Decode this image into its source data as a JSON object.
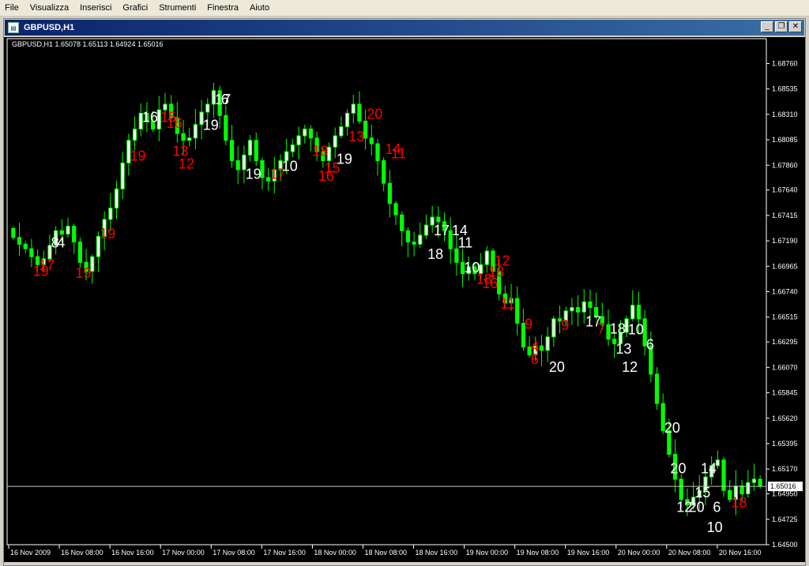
{
  "menu": [
    "File",
    "Visualizza",
    "Inserisci",
    "Grafici",
    "Strumenti",
    "Finestra",
    "Aiuto"
  ],
  "window": {
    "title": "GBPUSD,H1",
    "buttons": {
      "minimize": "_",
      "restore": "❐",
      "close": "✕"
    }
  },
  "chart_header": "GBPUSD,H1  1.65078 1.65113 1.64924 1.65016",
  "colors": {
    "bull": "#ffffff",
    "bear": "#00ff00",
    "label_white": "#ffffff",
    "label_red": "#ff0000",
    "axis": "#ffffff",
    "price_line": "#c0c0c0"
  },
  "chart_data": {
    "type": "candlestick",
    "symbol": "GBPUSD",
    "timeframe": "H1",
    "last_price": "1.65016",
    "ylim": [
      1.645,
      1.6898
    ],
    "y_ticks": [
      "1.68760",
      "1.68535",
      "1.68310",
      "1.68085",
      "1.67860",
      "1.67640",
      "1.67415",
      "1.67190",
      "1.66965",
      "1.66740",
      "1.66515",
      "1.66295",
      "1.66070",
      "1.65845",
      "1.65620",
      "1.65395",
      "1.65170",
      "1.64950",
      "1.64725",
      "1.64500"
    ],
    "x_ticks": [
      "16 Nov 2009",
      "16 Nov 08:00",
      "16 Nov 16:00",
      "17 Nov 00:00",
      "17 Nov 08:00",
      "17 Nov 16:00",
      "18 Nov 00:00",
      "18 Nov 08:00",
      "18 Nov 16:00",
      "19 Nov 00:00",
      "19 Nov 08:00",
      "19 Nov 16:00",
      "20 Nov 00:00",
      "20 Nov 08:00",
      "20 Nov 16:00"
    ],
    "close": [
      1.6722,
      1.6716,
      1.6712,
      1.6705,
      1.6698,
      1.6703,
      1.6715,
      1.6728,
      1.6725,
      1.6732,
      1.6718,
      1.67,
      1.6692,
      1.6705,
      1.6723,
      1.6738,
      1.6748,
      1.6765,
      1.6788,
      1.6808,
      1.6818,
      1.6832,
      1.6825,
      1.6818,
      1.6835,
      1.684,
      1.6828,
      1.6814,
      1.6808,
      1.681,
      1.6822,
      1.6833,
      1.684,
      1.6852,
      1.683,
      1.6808,
      1.679,
      1.6782,
      1.6795,
      1.6808,
      1.679,
      1.6775,
      1.6772,
      1.6782,
      1.679,
      1.6798,
      1.6804,
      1.6812,
      1.6818,
      1.681,
      1.6798,
      1.679,
      1.6802,
      1.6812,
      1.682,
      1.6832,
      1.684,
      1.6825,
      1.681,
      1.6805,
      1.679,
      1.677,
      1.6752,
      1.6742,
      1.6728,
      1.6718,
      1.6716,
      1.6724,
      1.6733,
      1.674,
      1.6736,
      1.6728,
      1.6712,
      1.67,
      1.669,
      1.6696,
      1.669,
      1.6698,
      1.671,
      1.6692,
      1.6672,
      1.6664,
      1.6668,
      1.6646,
      1.6625,
      1.6618,
      1.6626,
      1.6622,
      1.6634,
      1.665,
      1.6648,
      1.6657,
      1.666,
      1.6656,
      1.6665,
      1.666,
      1.6652,
      1.6645,
      1.6632,
      1.6628,
      1.6638,
      1.665,
      1.6662,
      1.665,
      1.6626,
      1.6601,
      1.6575,
      1.6551,
      1.653,
      1.6508,
      1.649,
      1.6485,
      1.6492,
      1.6498,
      1.651,
      1.652,
      1.6525,
      1.6498,
      1.649,
      1.6502,
      1.6495,
      1.6505,
      1.6508,
      1.6502
    ],
    "labels": [
      {
        "text": "8",
        "color": "white",
        "i": 7,
        "price": 1.6718
      },
      {
        "text": "4",
        "color": "white",
        "i": 8,
        "price": 1.6718
      },
      {
        "text": "19",
        "color": "red",
        "i": 4,
        "price": 1.6693
      },
      {
        "text": "17",
        "color": "red",
        "i": 5,
        "price": 1.6698
      },
      {
        "text": "19",
        "color": "red",
        "i": 11,
        "price": 1.6691
      },
      {
        "text": "19",
        "color": "red",
        "i": 15,
        "price": 1.6726
      },
      {
        "text": "19",
        "color": "red",
        "i": 20,
        "price": 1.6795
      },
      {
        "text": "16",
        "color": "white",
        "i": 22,
        "price": 1.6829
      },
      {
        "text": "15",
        "color": "red",
        "i": 25,
        "price": 1.6829
      },
      {
        "text": "16",
        "color": "red",
        "i": 26,
        "price": 1.6824
      },
      {
        "text": "13",
        "color": "red",
        "i": 27,
        "price": 1.6799
      },
      {
        "text": "12",
        "color": "red",
        "i": 28,
        "price": 1.6788
      },
      {
        "text": "19",
        "color": "white",
        "i": 32,
        "price": 1.6822
      },
      {
        "text": "17",
        "color": "white",
        "i": 34,
        "price": 1.6845
      },
      {
        "text": "6",
        "color": "white",
        "i": 35,
        "price": 1.6845
      },
      {
        "text": "19",
        "color": "white",
        "i": 39,
        "price": 1.6779
      },
      {
        "text": "17",
        "color": "red",
        "i": 43,
        "price": 1.6779
      },
      {
        "text": "10",
        "color": "white",
        "i": 45,
        "price": 1.6786
      },
      {
        "text": "18",
        "color": "red",
        "i": 50,
        "price": 1.6799
      },
      {
        "text": "16",
        "color": "red",
        "i": 51,
        "price": 1.6777
      },
      {
        "text": "15",
        "color": "red",
        "i": 52,
        "price": 1.6784
      },
      {
        "text": "19",
        "color": "white",
        "i": 54,
        "price": 1.6792
      },
      {
        "text": "13",
        "color": "red",
        "i": 56,
        "price": 1.6812
      },
      {
        "text": "20",
        "color": "red",
        "i": 59,
        "price": 1.6832
      },
      {
        "text": "14",
        "color": "red",
        "i": 62,
        "price": 1.6801
      },
      {
        "text": "11",
        "color": "red",
        "i": 63,
        "price": 1.6797
      },
      {
        "text": "17",
        "color": "white",
        "i": 70,
        "price": 1.6729
      },
      {
        "text": "14",
        "color": "white",
        "i": 73,
        "price": 1.6729
      },
      {
        "text": "11",
        "color": "white",
        "i": 74,
        "price": 1.6718
      },
      {
        "text": "18",
        "color": "white",
        "i": 69,
        "price": 1.6708
      },
      {
        "text": "10",
        "color": "white",
        "i": 75,
        "price": 1.6696
      },
      {
        "text": "12",
        "color": "red",
        "i": 80,
        "price": 1.6702
      },
      {
        "text": "18",
        "color": "red",
        "i": 77,
        "price": 1.6686
      },
      {
        "text": "16",
        "color": "red",
        "i": 78,
        "price": 1.6682
      },
      {
        "text": "18",
        "color": "red",
        "i": 79,
        "price": 1.6692
      },
      {
        "text": "11",
        "color": "red",
        "i": 81,
        "price": 1.6664
      },
      {
        "text": "9",
        "color": "red",
        "i": 85,
        "price": 1.6646
      },
      {
        "text": "4",
        "color": "red",
        "i": 86,
        "price": 1.6626
      },
      {
        "text": "6",
        "color": "red",
        "i": 86,
        "price": 1.6615
      },
      {
        "text": "20",
        "color": "white",
        "i": 89,
        "price": 1.6608
      },
      {
        "text": "9",
        "color": "red",
        "i": 91,
        "price": 1.6645
      },
      {
        "text": "7",
        "color": "red",
        "i": 97,
        "price": 1.6642
      },
      {
        "text": "17",
        "color": "white",
        "i": 95,
        "price": 1.6648
      },
      {
        "text": "18",
        "color": "white",
        "i": 99,
        "price": 1.6642
      },
      {
        "text": "10",
        "color": "white",
        "i": 102,
        "price": 1.6641
      },
      {
        "text": "13",
        "color": "white",
        "i": 100,
        "price": 1.6624
      },
      {
        "text": "6",
        "color": "white",
        "i": 105,
        "price": 1.6628
      },
      {
        "text": "12",
        "color": "white",
        "i": 101,
        "price": 1.6608
      },
      {
        "text": "20",
        "color": "white",
        "i": 108,
        "price": 1.6554
      },
      {
        "text": "20",
        "color": "white",
        "i": 109,
        "price": 1.6518
      },
      {
        "text": "14",
        "color": "white",
        "i": 114,
        "price": 1.6518
      },
      {
        "text": "15",
        "color": "white",
        "i": 113,
        "price": 1.6497
      },
      {
        "text": "12",
        "color": "white",
        "i": 110,
        "price": 1.6484
      },
      {
        "text": "20",
        "color": "white",
        "i": 112,
        "price": 1.6484
      },
      {
        "text": "6",
        "color": "white",
        "i": 116,
        "price": 1.6484
      },
      {
        "text": "10",
        "color": "white",
        "i": 115,
        "price": 1.6466
      },
      {
        "text": "18",
        "color": "red",
        "i": 119,
        "price": 1.6488
      }
    ]
  }
}
